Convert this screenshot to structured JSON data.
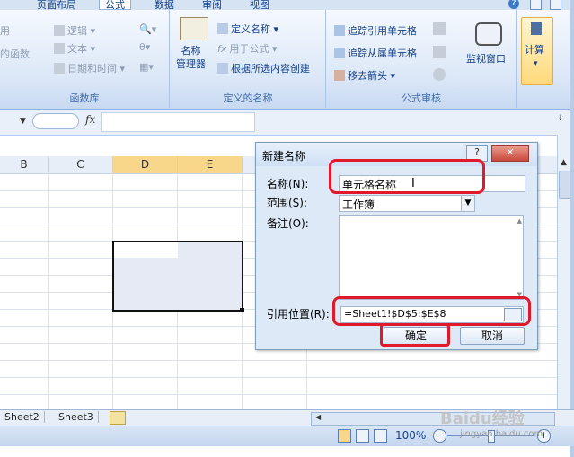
{
  "ribbon": {
    "tabs": [
      "页面布局",
      "公式",
      "数据",
      "审阅",
      "视图"
    ],
    "active_tab": "公式",
    "function_library": {
      "label": "函数库",
      "items": [
        "逻辑",
        "文本",
        "日期和时间"
      ],
      "left_fragments": [
        "用",
        "的函数"
      ]
    },
    "defined_names": {
      "label": "定义的名称",
      "name_manager": "名称\n管理器",
      "items": [
        "定义名称",
        "用于公式",
        "根据所选内容创建"
      ]
    },
    "formula_audit": {
      "label": "公式审核",
      "items": [
        "追踪引用单元格",
        "追踪从属单元格",
        "移去箭头"
      ],
      "watch_window": "监视窗口"
    },
    "calculation": {
      "label": "计算"
    }
  },
  "formula_bar": {
    "fx": "fx"
  },
  "columns": [
    {
      "name": "B",
      "selected": false
    },
    {
      "name": "C",
      "selected": false
    },
    {
      "name": "D",
      "selected": true
    },
    {
      "name": "E",
      "selected": true
    }
  ],
  "dialog": {
    "title": "新建名称",
    "help": "?",
    "close": "✕",
    "name_label": "名称(N):",
    "name_value": "单元格名称",
    "scope_label": "范围(S):",
    "scope_value": "工作簿",
    "comment_label": "备注(O):",
    "ref_label": "引用位置(R):",
    "ref_value": "=Sheet1!$D$5:$E$8",
    "ok_label": "确定",
    "cancel_label": "取消"
  },
  "sheets": [
    "Sheet2",
    "Sheet3"
  ],
  "status": {
    "zoom": "100%"
  },
  "watermark": {
    "text": "Baidu经验",
    "url": "jingyan.baidu.com"
  },
  "colors": {
    "highlight_red": "#e0192b",
    "selected_header": "#f8d68a",
    "ribbon_blue": "#15428b"
  }
}
